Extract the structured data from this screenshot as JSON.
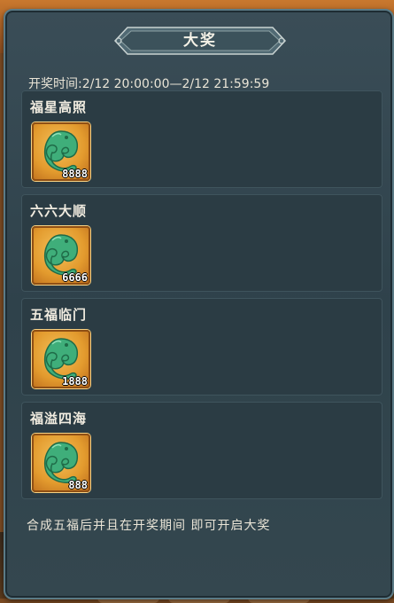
{
  "dialog": {
    "title": "大奖",
    "open_time": "开奖时间:2/12 20:00:00—2/12 21:59:59",
    "prizes": [
      {
        "name": "福星高照",
        "item_icon": "jade-dragon-icon",
        "count": "8888"
      },
      {
        "name": "六六大顺",
        "item_icon": "jade-dragon-icon",
        "count": "6666"
      },
      {
        "name": "五福临门",
        "item_icon": "jade-dragon-icon",
        "count": "1888"
      },
      {
        "name": "福溢四海",
        "item_icon": "jade-dragon-icon",
        "count": "888"
      }
    ],
    "footer_note": "合成五福后并且在开奖期间 即可开启大奖"
  },
  "colors": {
    "panel": "#34474f",
    "card": "#2b3c44",
    "slot": "#e39b2e",
    "jade": "#3fae7a"
  }
}
